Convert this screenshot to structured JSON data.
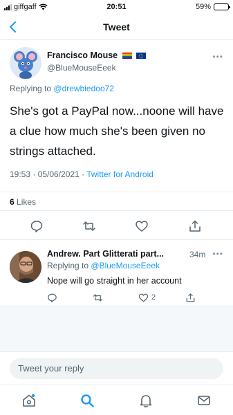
{
  "status_bar": {
    "carrier": "giffgaff",
    "time": "20:51",
    "battery": "59%",
    "battery_level": 0.59
  },
  "nav": {
    "title": "Tweet",
    "back_icon": "chevron-left-icon"
  },
  "main_tweet": {
    "author_name": "Francisco Mouse",
    "author_handle": "@BlueMouseEeek",
    "replying_prefix": "Replying to",
    "replying_to": "@drewbiedoo72",
    "text": "She's got a PayPal now...noone will have a clue how much she's been given no strings attached.",
    "timestamp": "19:53 · 05/06/2021 · ",
    "source": "Twitter for Android",
    "likes_count": "6",
    "likes_label": "Likes"
  },
  "reply": {
    "author_name": "Andrew. Part Glitterati part...",
    "time": "34m",
    "replying_prefix": "Replying to",
    "replying_to": "@BlueMouseEeek",
    "text": "Nope will go straight in her account",
    "like_count": "2"
  },
  "composer": {
    "placeholder": "Tweet your reply"
  },
  "colors": {
    "accent": "#1d9bf0",
    "secondary_text": "#536471",
    "divider": "#e6ecf0"
  }
}
